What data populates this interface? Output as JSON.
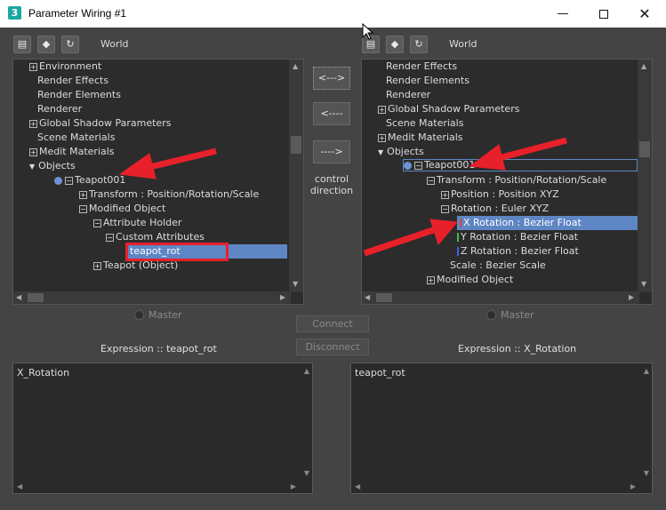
{
  "window": {
    "icon_text": "3",
    "title": "Parameter Wiring #1"
  },
  "left": {
    "world_label": "World",
    "tree": [
      "Environment",
      "Render Effects",
      "Render Elements",
      "Renderer",
      "Global Shadow Parameters",
      "Scene Materials",
      "Medit Materials",
      "Objects",
      "Teapot001",
      "Transform : Position/Rotation/Scale",
      "Modified Object",
      "Attribute Holder",
      "Custom  Attributes",
      "teapot_rot",
      "Teapot (Object)"
    ],
    "master_label": "Master",
    "expression_label": "Expression :: teapot_rot",
    "expression_text": "X_Rotation"
  },
  "right": {
    "world_label": "World",
    "tree": [
      "Render Effects",
      "Render Elements",
      "Renderer",
      "Global Shadow Parameters",
      "Scene Materials",
      "Medit Materials",
      "Objects",
      "Teapot001",
      "Transform : Position/Rotation/Scale",
      "Position : Position XYZ",
      "Rotation : Euler XYZ",
      "X Rotation : Bezier Float",
      "Y Rotation : Bezier Float",
      "Z Rotation : Bezier Float",
      "Scale : Bezier Scale",
      "Modified Object"
    ],
    "master_label": "Master",
    "expression_label": "Expression :: X_Rotation",
    "expression_text": "teapot_rot"
  },
  "middle": {
    "both_label": "<--->",
    "left_label": "<----",
    "right_label": "---->",
    "control_direction_1": "control",
    "control_direction_2": "direction",
    "connect_label": "Connect",
    "disconnect_label": "Disconnect"
  },
  "colors": {
    "selection": "#5e86c4",
    "annotation_red": "#e8202a"
  }
}
